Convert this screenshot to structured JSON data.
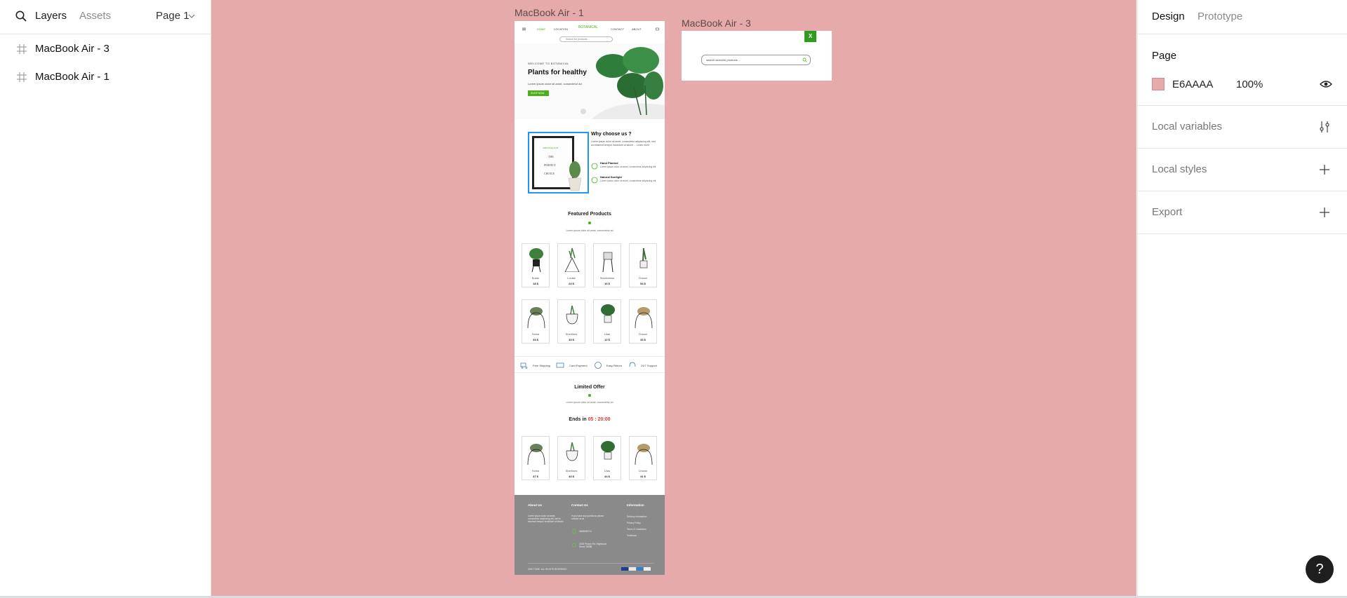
{
  "left_panel": {
    "tab_layers": "Layers",
    "tab_assets": "Assets",
    "page_selector": "Page 1",
    "layers": [
      {
        "label": "MacBook Air - 3"
      },
      {
        "label": "MacBook Air - 1"
      }
    ]
  },
  "canvas": {
    "frame1_label": "MacBook Air - 1",
    "frame3_label": "MacBook Air - 3",
    "frame1": {
      "nav": [
        "HOME",
        "LOCATION",
        "BOTANICAL",
        "CONTACT",
        "ABOUT"
      ],
      "search_placeholder": "Search for products ...",
      "hero_welcome": "WELCOME TO BOTANICAL",
      "hero_title": "Plants for healthy",
      "hero_text": "Lorem ipsum dolor sit amet, consectetur ad",
      "hero_button": "SHOP NOW",
      "card_lines": [
        "ARRANGE FOR",
        "THE",
        "PERFECT",
        "CHOICE"
      ],
      "why_title": "Why choose us ?",
      "why_text": "Lorem ipsum dolor sit amet, consectetur adipiscing elit, sed do eiusmod tempor incididunt ut labore ... Learn more",
      "why_items": [
        {
          "title": "Hand Planted",
          "text": "Lorem ipsum dolor sit amet, consectetur adipiscing elit"
        },
        {
          "title": "Natural Sunlight",
          "text": "Lorem ipsum dolor sit amet, consectetur adipiscing elit"
        }
      ],
      "featured_title": "Featured Products",
      "featured_sub": "Lorem ipsum dolor sit amet, consectetur ad",
      "products_row1": [
        {
          "name": "Butter",
          "price": "18 $"
        },
        {
          "name": "Louise",
          "price": "24 $"
        },
        {
          "name": "Stacevision",
          "price": "16 $"
        },
        {
          "name": "Chione",
          "price": "54 $"
        }
      ],
      "products_row2": [
        {
          "name": "Holna",
          "price": "33 $"
        },
        {
          "name": "Sherlines",
          "price": "33 $"
        },
        {
          "name": "Lilas",
          "price": "12 $"
        },
        {
          "name": "Chione",
          "price": "33 $"
        }
      ],
      "features": [
        "Free Shipping",
        "Card Payment",
        "Easy Return",
        "24/7 Support"
      ],
      "limited_title": "Limited Offer",
      "limited_sub": "Lorem ipsum dolor sit amet, consectetur ad",
      "ends_label": "Ends in",
      "ends_time": "05 : 20:00",
      "products_row3": [
        {
          "name": "Holna",
          "price": "47 $"
        },
        {
          "name": "Sherlines",
          "price": "43 $"
        },
        {
          "name": "Lilas",
          "price": "44 $"
        },
        {
          "name": "Chione",
          "price": "41 $"
        }
      ],
      "footer": {
        "about_title": "About Us",
        "about_text": "Lorem ipsum dolor sit amet, consectetur adipiscing elit, sed to eiusmod tempor incididunt ut labore.",
        "contact_title": "Contact Us",
        "contact_text": "If you have any questions please contact us at",
        "phone": "0658545713",
        "address": "1615 Proctor Rd, Highwood Street 78988",
        "info_title": "Information",
        "info_links": [
          "Delivery Information",
          "Privacy Policy",
          "Terms & Conditions",
          "Feedback"
        ],
        "copyright": "2020 TOME. ALL RIGHTS RESERVED"
      }
    },
    "frame3": {
      "close_label": "X",
      "search_placeholder": "search searchin products ..."
    }
  },
  "right_panel": {
    "tab_design": "Design",
    "tab_prototype": "Prototype",
    "page_section": "Page",
    "page_color_hex": "E6AAAA",
    "page_opacity": "100%",
    "local_variables": "Local variables",
    "local_styles": "Local styles",
    "export": "Export"
  },
  "help_label": "?",
  "colors": {
    "canvas_bg": "#E6AAAA",
    "accent_green": "#4caf1a",
    "footer_bg": "#8a8a8a",
    "countdown_red": "#e53935"
  }
}
